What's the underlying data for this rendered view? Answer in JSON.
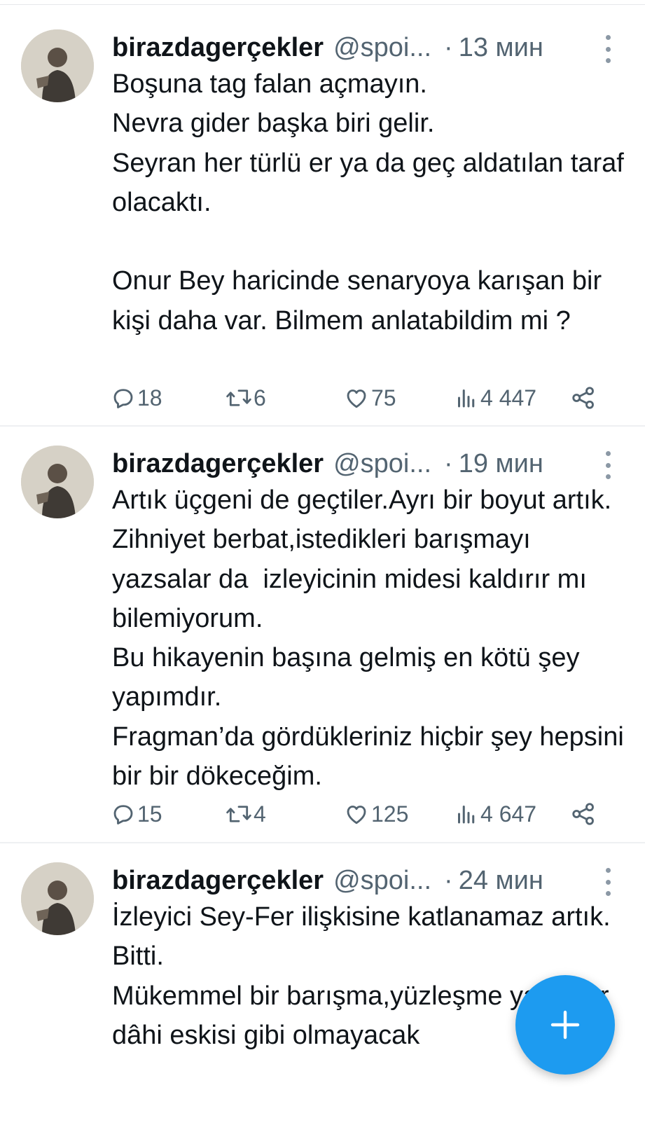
{
  "tweets": [
    {
      "name": "birazdagerçekler",
      "handle": "@spoi...",
      "dot": "·",
      "time": "13 мин",
      "text": "Boşuna tag falan açmayın.\nNevra gider başka biri gelir.\nSeyran her türlü er ya da geç aldatılan taraf olacaktı.\n\nOnur Bey haricinde senaryoya karışan bir kişi daha var. Bilmem anlatabildim mi ?",
      "replies": "18",
      "retweets": "6",
      "likes": "75",
      "views": "4 447"
    },
    {
      "name": "birazdagerçekler",
      "handle": "@spoi...",
      "dot": "·",
      "time": "19 мин",
      "text": "Artık üçgeni de geçtiler.Ayrı bir boyut artık. Zihniyet berbat,istedikleri barışmayı yazsalar da  izleyicinin midesi kaldırır mı bilemiyorum.\nBu hikayenin başına gelmiş en kötü şey yapımdır.\nFragman’da gördükleriniz hiçbir şey hepsini bir bir dökeceğim.",
      "replies": "15",
      "retweets": "4",
      "likes": "125",
      "views": "4 647"
    },
    {
      "name": "birazdagerçekler",
      "handle": "@spoi...",
      "dot": "·",
      "time": "24 мин",
      "text": "İzleyici Sey-Fer ilişkisine katlanamaz artık.\nBitti.\nMükemmel bir barışma,yüzleşme yazsalar  dâhi eskisi gibi olmayacak"
    }
  ],
  "icons": {
    "reply": "reply-icon",
    "retweet": "retweet-icon",
    "like": "heart-icon",
    "views": "views-icon",
    "share": "share-icon",
    "more": "more-vertical-icon",
    "compose": "plus-icon"
  },
  "colors": {
    "accent": "#1d9bf0",
    "secondary_text": "#536471",
    "primary_text": "#0f1419"
  }
}
